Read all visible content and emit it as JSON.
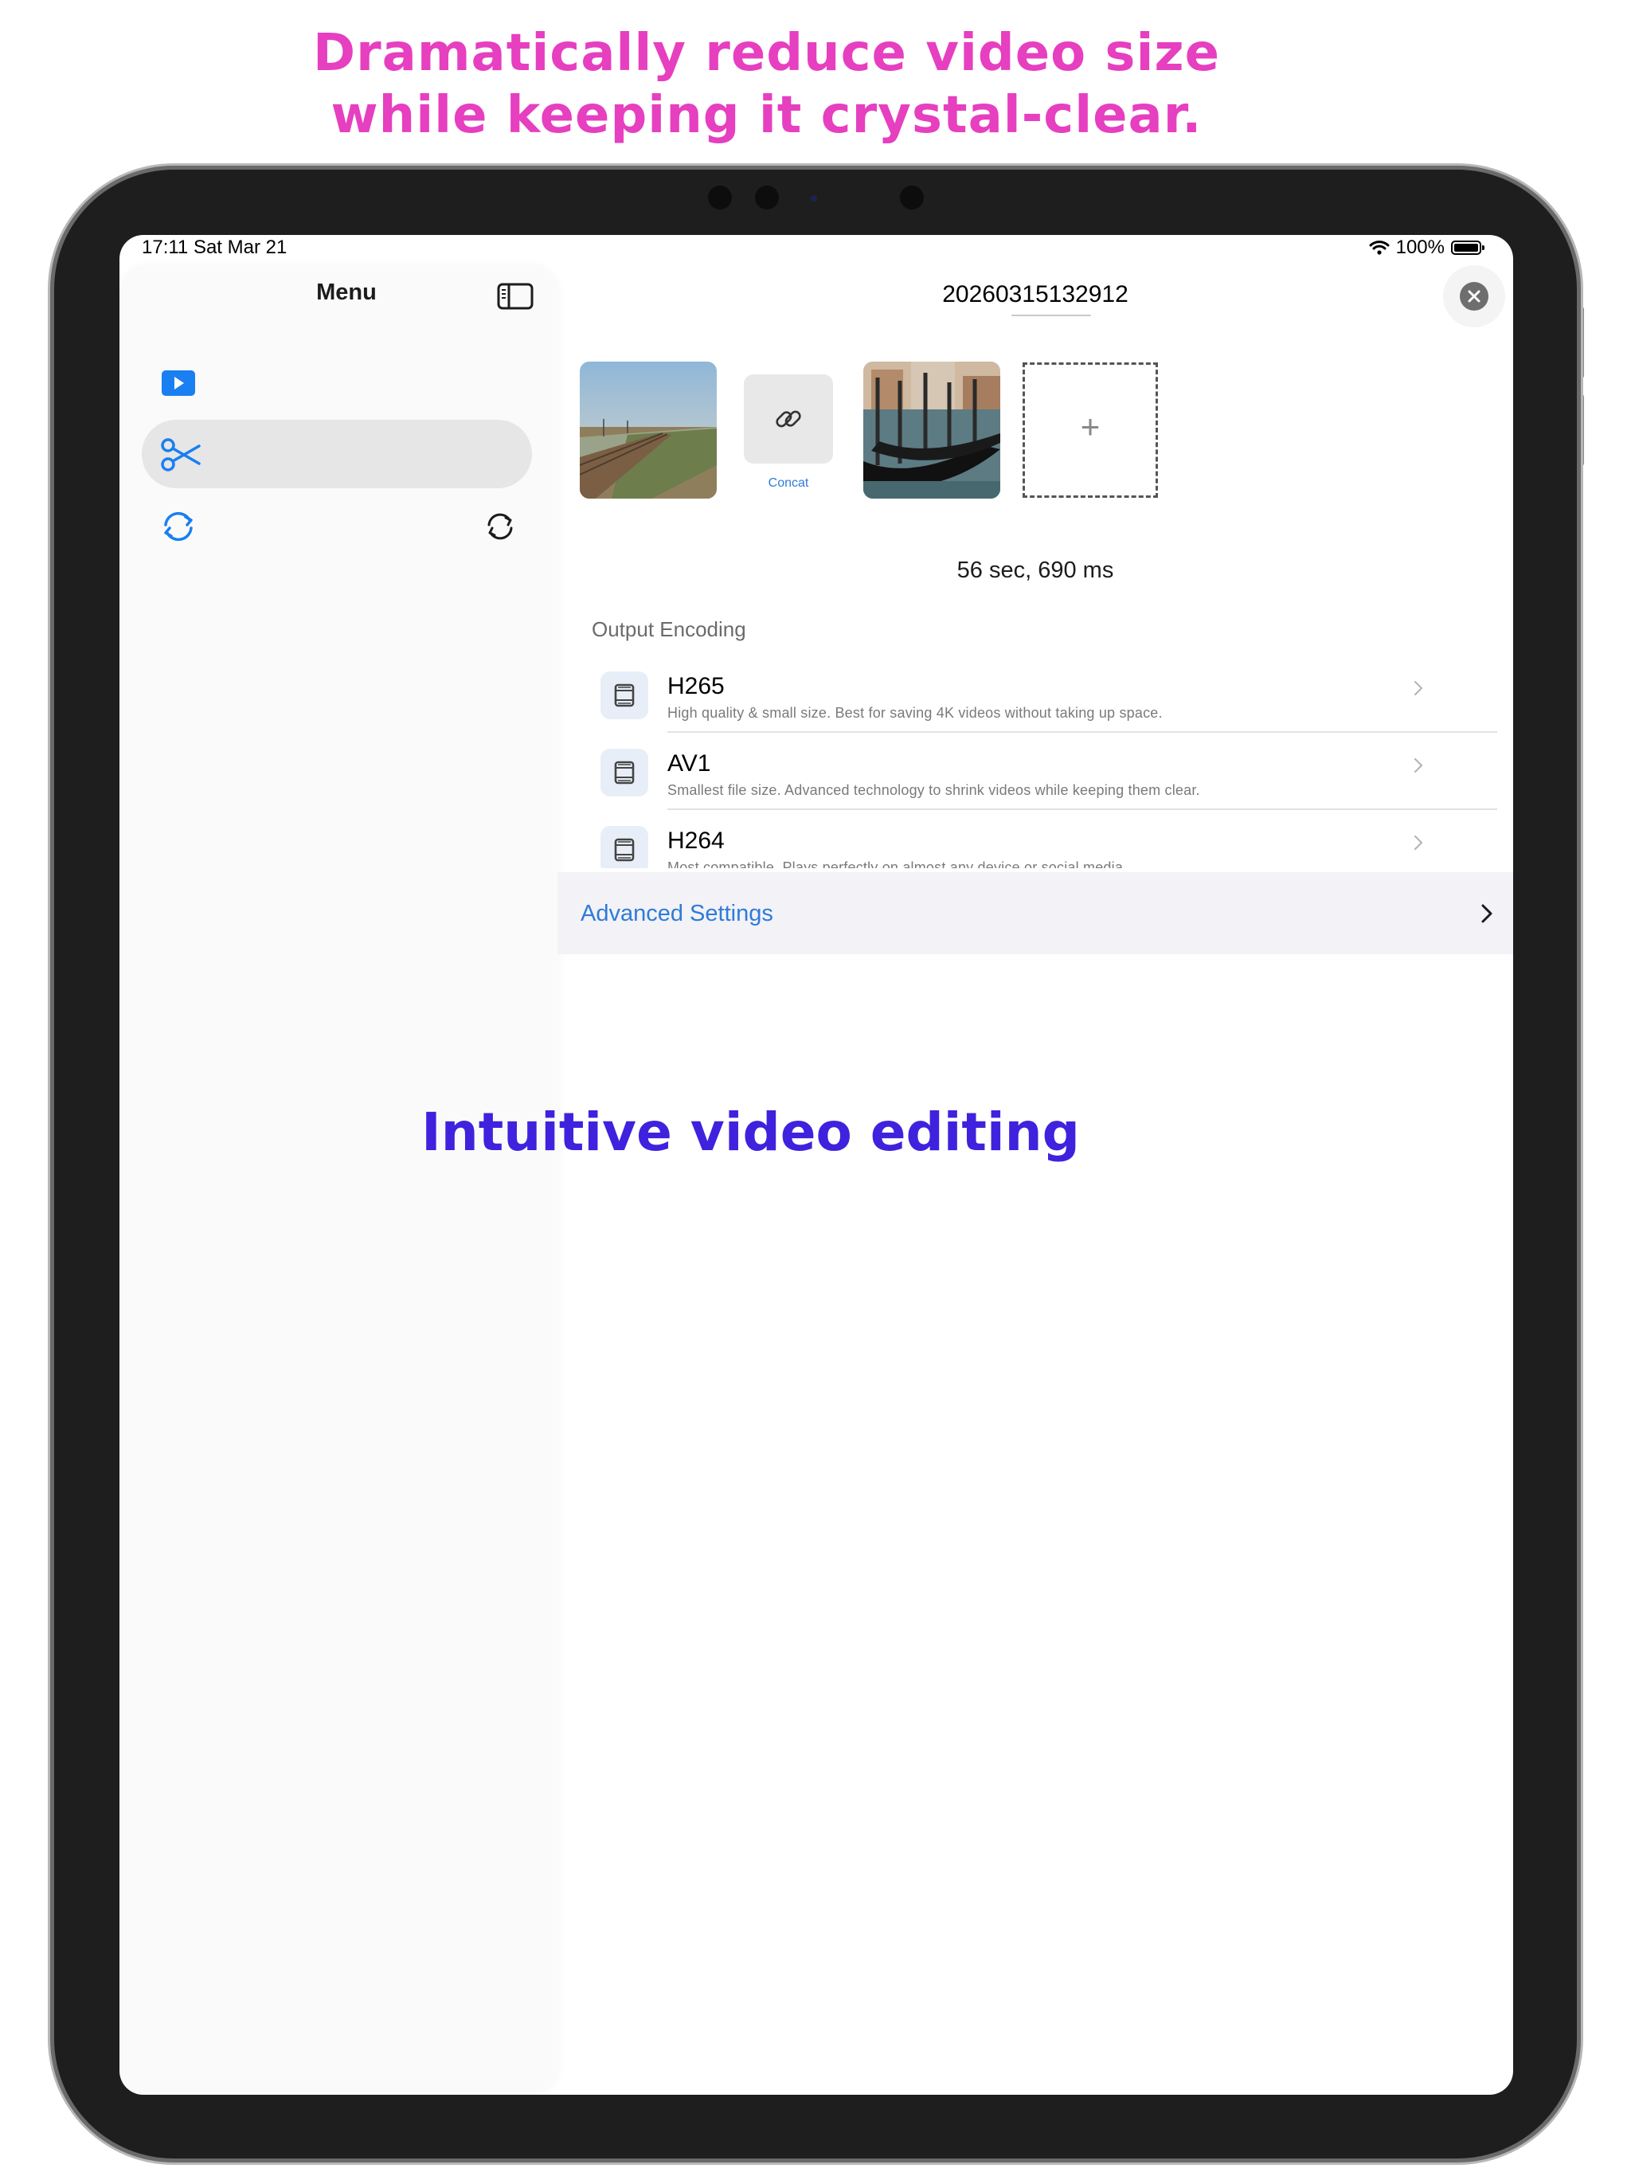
{
  "promo": {
    "headline_line1": "Dramatically reduce video size",
    "headline_line2": "while keeping it crystal-clear.",
    "caption": "Intuitive video editing",
    "headline_color": "#e63fc0",
    "caption_color": "#3f22dd"
  },
  "status_bar": {
    "time_date": "17:11  Sat Mar 21",
    "battery": "100%",
    "icons": [
      "wifi-icon",
      "battery-icon"
    ]
  },
  "sidebar": {
    "title": "Menu",
    "toggle_icon": "sidebar-toggle-icon",
    "items": [
      {
        "icon": "play-icon",
        "selected": false
      },
      {
        "icon": "scissors-icon",
        "selected": true
      },
      {
        "icon": "sync-icon",
        "secondary_icon": "refresh-icon",
        "selected": false
      }
    ]
  },
  "editor": {
    "title": "20260315132912",
    "close_icon": "close-icon",
    "clips": [
      {
        "type": "video",
        "scene": "coastal-railway"
      },
      {
        "type": "link",
        "label": "Concat",
        "icon": "link-icon"
      },
      {
        "type": "video",
        "scene": "venice-gondolas"
      },
      {
        "type": "add",
        "symbol": "+"
      }
    ],
    "duration": "56 sec, 690 ms",
    "output_encoding": {
      "header": "Output Encoding",
      "options": [
        {
          "name": "H265",
          "description": "High quality & small size. Best for saving 4K videos without taking up space.",
          "icon": "film-icon"
        },
        {
          "name": "AV1",
          "description": "Smallest file size. Advanced technology to shrink videos while keeping them clear.",
          "icon": "film-icon"
        },
        {
          "name": "H264",
          "description": "Most compatible. Plays perfectly on almost any device or social media.",
          "icon": "film-icon"
        }
      ]
    },
    "advanced_settings": "Advanced Settings",
    "accent_color": "#2f7bd8"
  }
}
